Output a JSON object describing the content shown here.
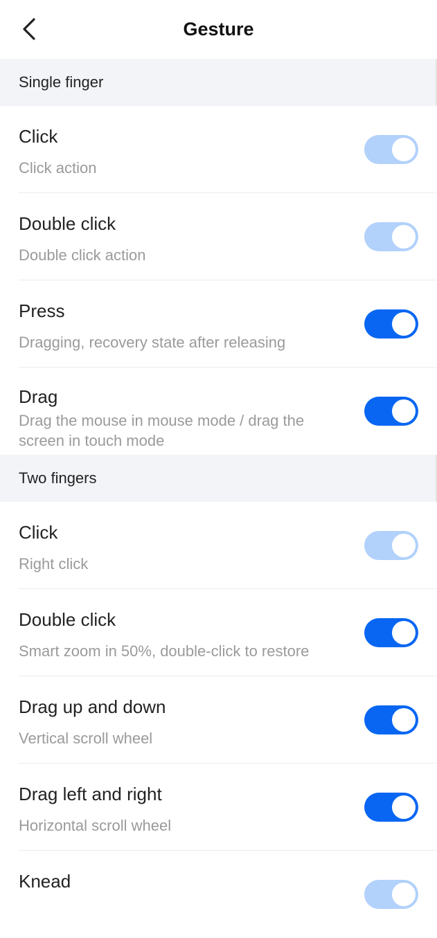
{
  "header": {
    "title": "Gesture",
    "back_icon": "chevron-left-icon"
  },
  "sections": [
    {
      "label": "Single finger",
      "items": [
        {
          "title": "Click",
          "subtitle": "Click action",
          "enabled": true,
          "disabled": true
        },
        {
          "title": "Double click",
          "subtitle": "Double click action",
          "enabled": true,
          "disabled": true
        },
        {
          "title": "Press",
          "subtitle": "Dragging, recovery state after releasing",
          "enabled": true,
          "disabled": false
        },
        {
          "title": "Drag",
          "subtitle": "Drag the mouse in mouse mode / drag the screen in touch mode",
          "enabled": true,
          "disabled": false
        }
      ]
    },
    {
      "label": "Two fingers",
      "items": [
        {
          "title": "Click",
          "subtitle": "Right click",
          "enabled": true,
          "disabled": true
        },
        {
          "title": "Double click",
          "subtitle": "Smart zoom in 50%, double-click to restore",
          "enabled": true,
          "disabled": false
        },
        {
          "title": "Drag up and down",
          "subtitle": "Vertical scroll wheel",
          "enabled": true,
          "disabled": false
        },
        {
          "title": "Drag left and right",
          "subtitle": "Horizontal scroll wheel",
          "enabled": true,
          "disabled": false
        },
        {
          "title": "Knead",
          "subtitle": "",
          "enabled": true,
          "disabled": true
        }
      ]
    }
  ],
  "colors": {
    "toggle_on": "#0866f2",
    "toggle_on_disabled": "#b2d1fb",
    "section_bg": "#f2f4f8"
  }
}
